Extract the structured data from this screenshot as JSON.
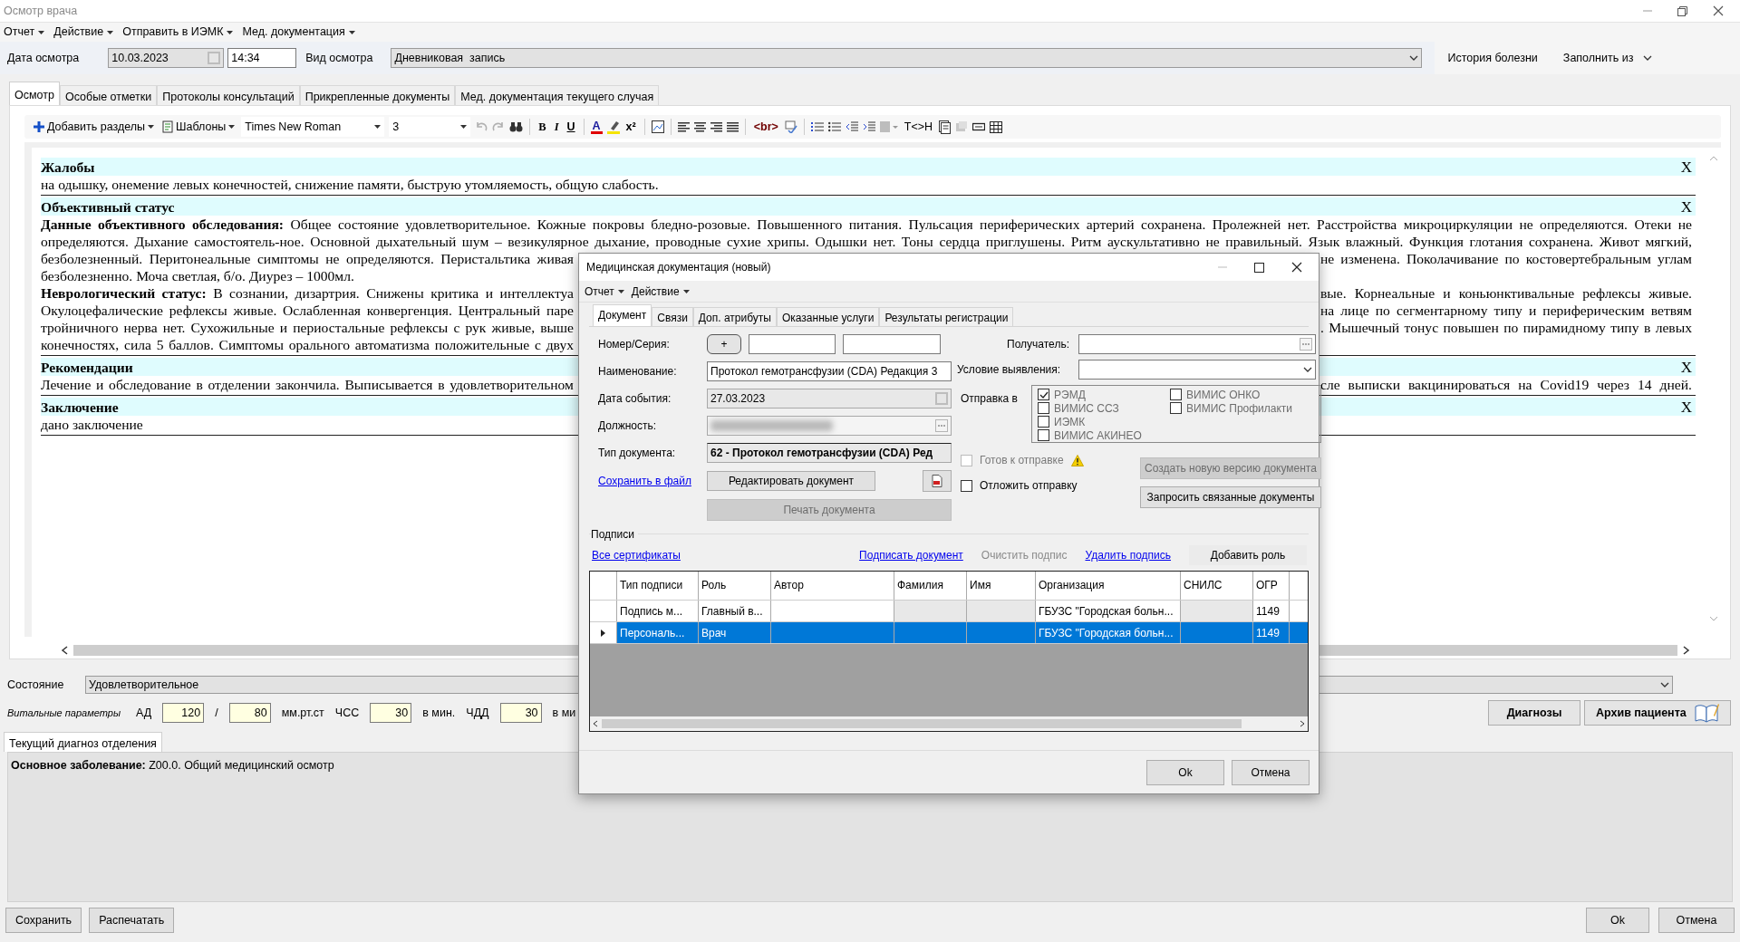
{
  "window": {
    "title": "Осмотр врача"
  },
  "menu": [
    "Отчет",
    "Действие",
    "Отправить в ИЭМК",
    "Мед. документация"
  ],
  "exam": {
    "date_label": "Дата осмотра",
    "date": "10.03.2023",
    "time": "14:34",
    "type_label": "Вид осмотра",
    "type": "Дневниковая  запись"
  },
  "header_actions": [
    {
      "label": "История болезни",
      "dropdown": false
    },
    {
      "label": "Заполнить из",
      "dropdown": true
    }
  ],
  "tabs": [
    {
      "label": "Осмотр",
      "selected": true
    },
    {
      "label": "Особые отметки",
      "selected": false
    },
    {
      "label": "Протоколы консультаций",
      "selected": false
    },
    {
      "label": "Прикрепленные документы",
      "selected": false
    },
    {
      "label": "Мед. документация текущего случая",
      "selected": false
    }
  ],
  "toolbar": {
    "add_sections": "Добавить разделы",
    "templates": "Шаблоны",
    "font": "Times New Roman",
    "font_size": "3",
    "undo": {
      "disabled": true
    },
    "redo": {
      "disabled": true
    },
    "bold": "B",
    "italic": "I",
    "underline": "U",
    "font_color": "A",
    "superscript": "x²",
    "line_break": "<br>",
    "tag_toggle": "T<>H"
  },
  "sections": [
    {
      "title": "Жалобы",
      "close": "X",
      "lines": [
        {
          "kind": "end",
          "text": "на одышку, онемение левых конечностей, снижение памяти, быструю утомляемость, общую слабость."
        }
      ]
    },
    {
      "title": "Объективный статус",
      "close": "X",
      "lines": [
        {
          "kind": "full",
          "text": "**Данные объективного обследования:** Общее состояние удовлетворительное. Кожные покровы бледно-розовые. Повышенного питания. Пульсация периферических артерий сохранена. Пролежней нет. Расстройства микроциркуляции не определяются. Отеки не"
        },
        {
          "kind": "full",
          "text": "определяются. Дыхание самостоятель-ное. Основной дыхательный шум – везикулярное дыхание, проводные сухие хрипы. Одышки нет. Тоны сердца приглушены. Ритм аускультативно не правильный. Язык влажный. Функция глотания сохранена. Живот мягкий,"
        },
        {
          "kind": "split",
          "left": "безболезненный. Перитонеальные симптомы не определяются. Перистальтика живая",
          "right": "не изменена. Поколачивание по костовертебральным углам"
        },
        {
          "kind": "end",
          "text": "безболезненно. Моча светлая, б/о. Диурез – 1000мл."
        },
        {
          "kind": "split",
          "left": "**Неврологический статус:** В сознании, дизартрия. Снижены критика и интеллектуа",
          "right": "вые. Корнеальные и коньюнктивальные рефлексы живые."
        },
        {
          "kind": "split",
          "left": "Окулоцефалические рефлексы живые. Ослабленная конвергенция. Центральный паре",
          "right": "на лице по сегментарному типу и периферическим ветвям"
        },
        {
          "kind": "split",
          "left": "тройничного нерва нет. Сухожильные и периостальные рефлексы с рук живые, выше",
          "right": ". Мышечный тонус повышен по пирамидному типу в левых"
        },
        {
          "kind": "left",
          "left": "конечностях, сила 5 баллов. Симптомы орального автоматизма положительные с двух"
        }
      ]
    },
    {
      "title": "Рекомендации",
      "close": "X",
      "lines": [
        {
          "kind": "split",
          "left": "Лечение и обследование в отделении закончила. Выписывается в удовлетворительном",
          "right": "сле выписки вакцинироваться на Covid19 через 14 дней."
        }
      ]
    },
    {
      "title": "Заключение",
      "close": "X",
      "lines": [
        {
          "kind": "end",
          "text": "дано заключение"
        }
      ]
    }
  ],
  "state": {
    "label": "Состояние",
    "value": "Удовлетворительное"
  },
  "vitals": {
    "label": "Витальные параметры",
    "items": [
      {
        "kind": "text",
        "text": "АД"
      },
      {
        "kind": "input",
        "value": "120"
      },
      {
        "kind": "text",
        "text": "/"
      },
      {
        "kind": "input",
        "value": "80"
      },
      {
        "kind": "text",
        "text": "мм.рт.ст"
      },
      {
        "kind": "text",
        "text": "ЧСС"
      },
      {
        "kind": "input",
        "value": "30"
      },
      {
        "kind": "text",
        "text": "в мин."
      },
      {
        "kind": "text",
        "text": "ЧДД"
      },
      {
        "kind": "input",
        "value": "30"
      },
      {
        "kind": "text",
        "text": "в ми"
      }
    ]
  },
  "side_buttons": [
    "Диагнозы",
    "Архив пациента"
  ],
  "diagnosis": {
    "tab": "Текущий диагноз отделения",
    "text": "**Основное заболевание:** Z00.0. Общий медицинский осмотр"
  },
  "footer": {
    "left": [
      "Сохранить",
      "Распечатать"
    ],
    "right": [
      "Ok",
      "Отмена"
    ]
  },
  "dialog": {
    "title": "Медицинская документация (новый)",
    "menu": [
      "Отчет",
      "Действие"
    ],
    "tabs": [
      {
        "label": "Документ",
        "selected": true
      },
      {
        "label": "Связи",
        "selected": false
      },
      {
        "label": "Доп. атрибуты",
        "selected": false
      },
      {
        "label": "Оказанные услуги",
        "selected": false
      },
      {
        "label": "Результаты регистрации",
        "selected": false
      }
    ],
    "number_label": "Номер/Серия:",
    "add_button": "+",
    "name_label": "Наименование:",
    "name_value": "Протокол гемотрансфузии (CDA) Редакция 3",
    "event_date_label": "Дата события:",
    "event_date": "27.03.2023",
    "position_label": "Должность:",
    "doc_type_label": "Тип документа:",
    "doc_type": "62 - Протокол гемотрансфузии (CDA) Ред",
    "save_link": "Сохранить в файл",
    "edit_button": "Редактировать документ",
    "print_button": {
      "label": "Печать документа",
      "disabled": true
    },
    "recipient_label": "Получатель:",
    "condition_label": "Условие выявления:",
    "send_label": "Отправка в",
    "send_columns": [
      [
        {
          "label": "РЭМД",
          "checked": true
        },
        {
          "label": "ВИМИС ССЗ",
          "checked": false
        },
        {
          "label": "ИЭМК",
          "checked": false
        },
        {
          "label": "ВИМИС АКИНЕО",
          "checked": false
        }
      ],
      [
        {
          "label": "ВИМИС ОНКО",
          "checked": false
        },
        {
          "label": "ВИМИС Профилакти",
          "checked": false
        }
      ]
    ],
    "ready": {
      "label": "Готов к отправке",
      "checked": false,
      "disabled": true
    },
    "postpone": {
      "label": "Отложить отправку",
      "checked": false,
      "disabled": false
    },
    "new_version": {
      "label": "Создать новую версию документа",
      "disabled": true
    },
    "request_related": {
      "label": "Запросить связанные документы",
      "disabled": false
    },
    "signatures": {
      "title": "Подписи",
      "links": [
        {
          "label": "Все сертификаты",
          "disabled": false
        },
        {
          "label": "Подписать документ",
          "disabled": false
        },
        {
          "label": "Очистить подпис",
          "disabled": true
        },
        {
          "label": "Удалить подпись",
          "disabled": false
        }
      ],
      "add_role": "Добавить роль",
      "columns": [
        "Тип подписи",
        "Роль",
        "Автор",
        "Фамилия",
        "Имя",
        "Организация",
        "СНИЛС",
        "ОГР"
      ],
      "rows": [
        {
          "selected": false,
          "cells": [
            "Подпись м...",
            "Главный в...",
            "",
            "",
            "",
            "ГБУЗС \"Городская больн...",
            "",
            "1149"
          ]
        },
        {
          "selected": true,
          "cells": [
            "Персональ...",
            "Врач",
            "",
            "",
            "",
            "ГБУЗС \"Городская больн...",
            "",
            "1149"
          ]
        }
      ]
    },
    "buttons": [
      "Ok",
      "Отмена"
    ]
  }
}
